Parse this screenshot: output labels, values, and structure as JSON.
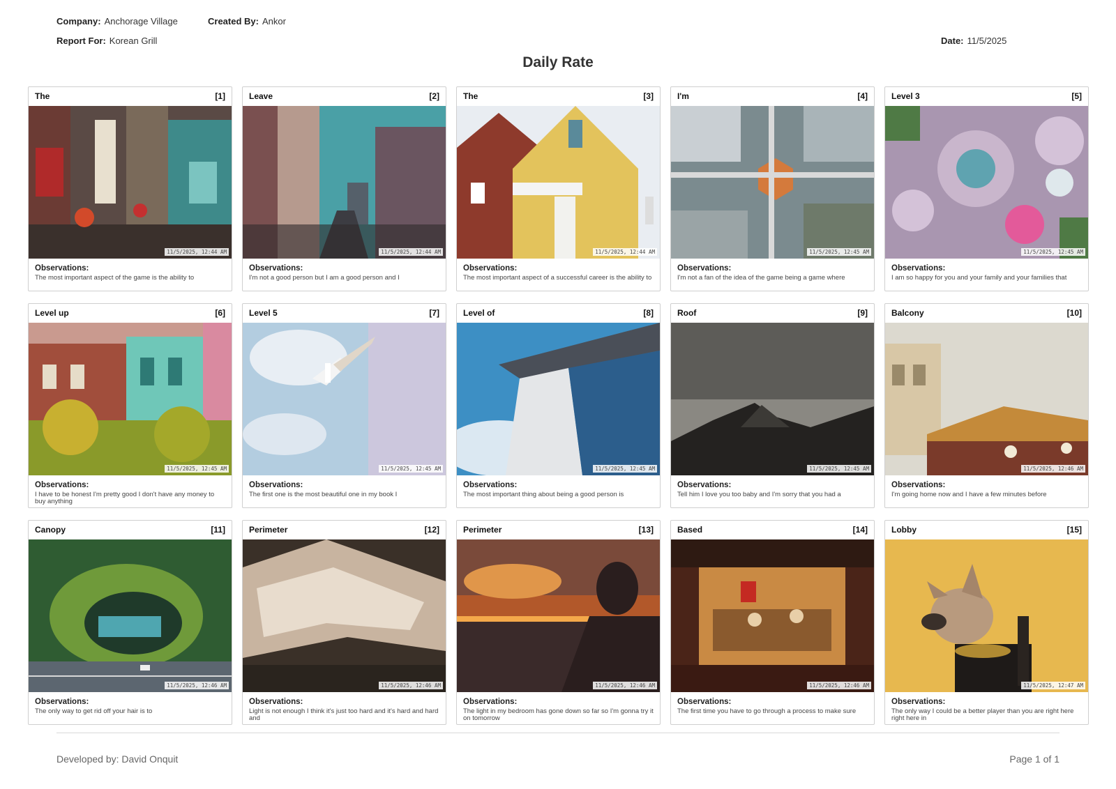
{
  "header": {
    "company_label": "Company:",
    "company": "Anchorage Village",
    "created_label": "Created By:",
    "created_by": "Ankor",
    "report_label": "Report For:",
    "report_for": "Korean Grill",
    "date_label": "Date:",
    "date": "11/5/2025"
  },
  "title": "Daily Rate",
  "obs_label": "Observations:",
  "cards": [
    {
      "label": "The",
      "num": "[1]",
      "time": "11/5/2025, 12:44 AM",
      "obs": "The most important aspect of the game is the ability to",
      "scene": "street-market"
    },
    {
      "label": "Leave",
      "num": "[2]",
      "time": "11/5/2025, 12:44 AM",
      "obs": "I'm not a good person but I am a good person and I",
      "scene": "city-street"
    },
    {
      "label": "The",
      "num": "[3]",
      "time": "11/5/2025, 12:44 AM",
      "obs": "The most important aspect of a successful career is the ability to",
      "scene": "houses"
    },
    {
      "label": "I'm",
      "num": "[4]",
      "time": "11/5/2025, 12:45 AM",
      "obs": "I'm not a fan of the idea of the game being a game where",
      "scene": "aerial-city"
    },
    {
      "label": "Level 3",
      "num": "[5]",
      "time": "11/5/2025, 12:45 AM",
      "obs": "I am so happy for you and your family and your families that",
      "scene": "garden-aerial"
    },
    {
      "label": "Level up",
      "num": "[6]",
      "time": "11/5/2025, 12:45 AM",
      "obs": "I have to be honest I'm pretty good I don't have any money to buy anything",
      "scene": "shophouses"
    },
    {
      "label": "Level 5",
      "num": "[7]",
      "time": "11/5/2025, 12:45 AM",
      "obs": "The first one is the most beautiful one in my book I",
      "scene": "seagull"
    },
    {
      "label": "Level of",
      "num": "[8]",
      "time": "11/5/2025, 12:45 AM",
      "obs": "The most important thing about being a good person is",
      "scene": "tower"
    },
    {
      "label": "Roof",
      "num": "[9]",
      "time": "11/5/2025, 12:45 AM",
      "obs": "Tell him I love you too baby and I'm sorry that you had a",
      "scene": "mountains"
    },
    {
      "label": "Balcony",
      "num": "[10]",
      "time": "11/5/2025, 12:46 AM",
      "obs": "I'm going home now and I have a few minutes before",
      "scene": "carousel"
    },
    {
      "label": "Canopy",
      "num": "[11]",
      "time": "11/5/2025, 12:46 AM",
      "obs": "The only way to get rid off your hair is to",
      "scene": "canopy"
    },
    {
      "label": "Perimeter",
      "num": "[12]",
      "time": "11/5/2025, 12:46 AM",
      "obs": "Light is not enough I think it's just too hard and it's hard and hard and",
      "scene": "waves"
    },
    {
      "label": "Perimeter",
      "num": "[13]",
      "time": "11/5/2025, 12:46 AM",
      "obs": "The light in my bedroom has gone down so far so I'm gonna try it on tomorrow",
      "scene": "sunset"
    },
    {
      "label": "Based",
      "num": "[14]",
      "time": "11/5/2025, 12:46 AM",
      "obs": "The first time you have to go through a process to make sure",
      "scene": "restaurant"
    },
    {
      "label": "Lobby",
      "num": "[15]",
      "time": "11/5/2025, 12:47 AM",
      "obs": "The only way I could be a better player than you are right here right here in",
      "scene": "dog"
    }
  ],
  "footer": {
    "developed": "Developed by: David Onquit",
    "page": "Page 1 of 1"
  }
}
